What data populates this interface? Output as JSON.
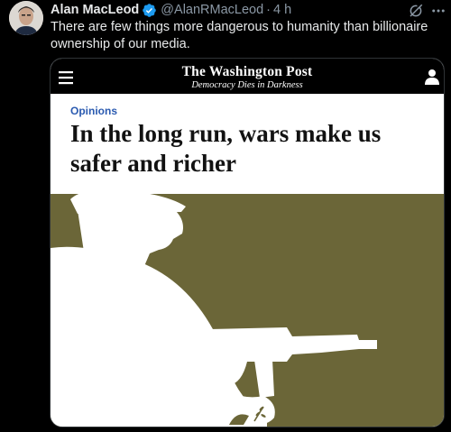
{
  "author": {
    "name": "Alan MacLeod",
    "handle": "@AlanRMacLeod",
    "separator": "·",
    "time": "4 h"
  },
  "tweet": {
    "text": "There are few things more dangerous to humanity than billionaire ownership of our media."
  },
  "media": {
    "masthead": "The Washington Post",
    "tagline": "Democracy Dies in Darkness",
    "section": "Opinions",
    "headline": "In the long run, wars make us safer and richer"
  },
  "icons": {
    "verified": "verified-badge-icon",
    "grok": "grok-icon",
    "more": "more-icon",
    "menu": "hamburger-menu-icon",
    "user": "user-icon"
  },
  "colors": {
    "background": "#000000",
    "text": "#e7e9ea",
    "muted": "#8b98a5",
    "verified": "#1d9bf0",
    "opinions_label": "#2a5ab0",
    "illustration_bg": "#6b6638"
  }
}
